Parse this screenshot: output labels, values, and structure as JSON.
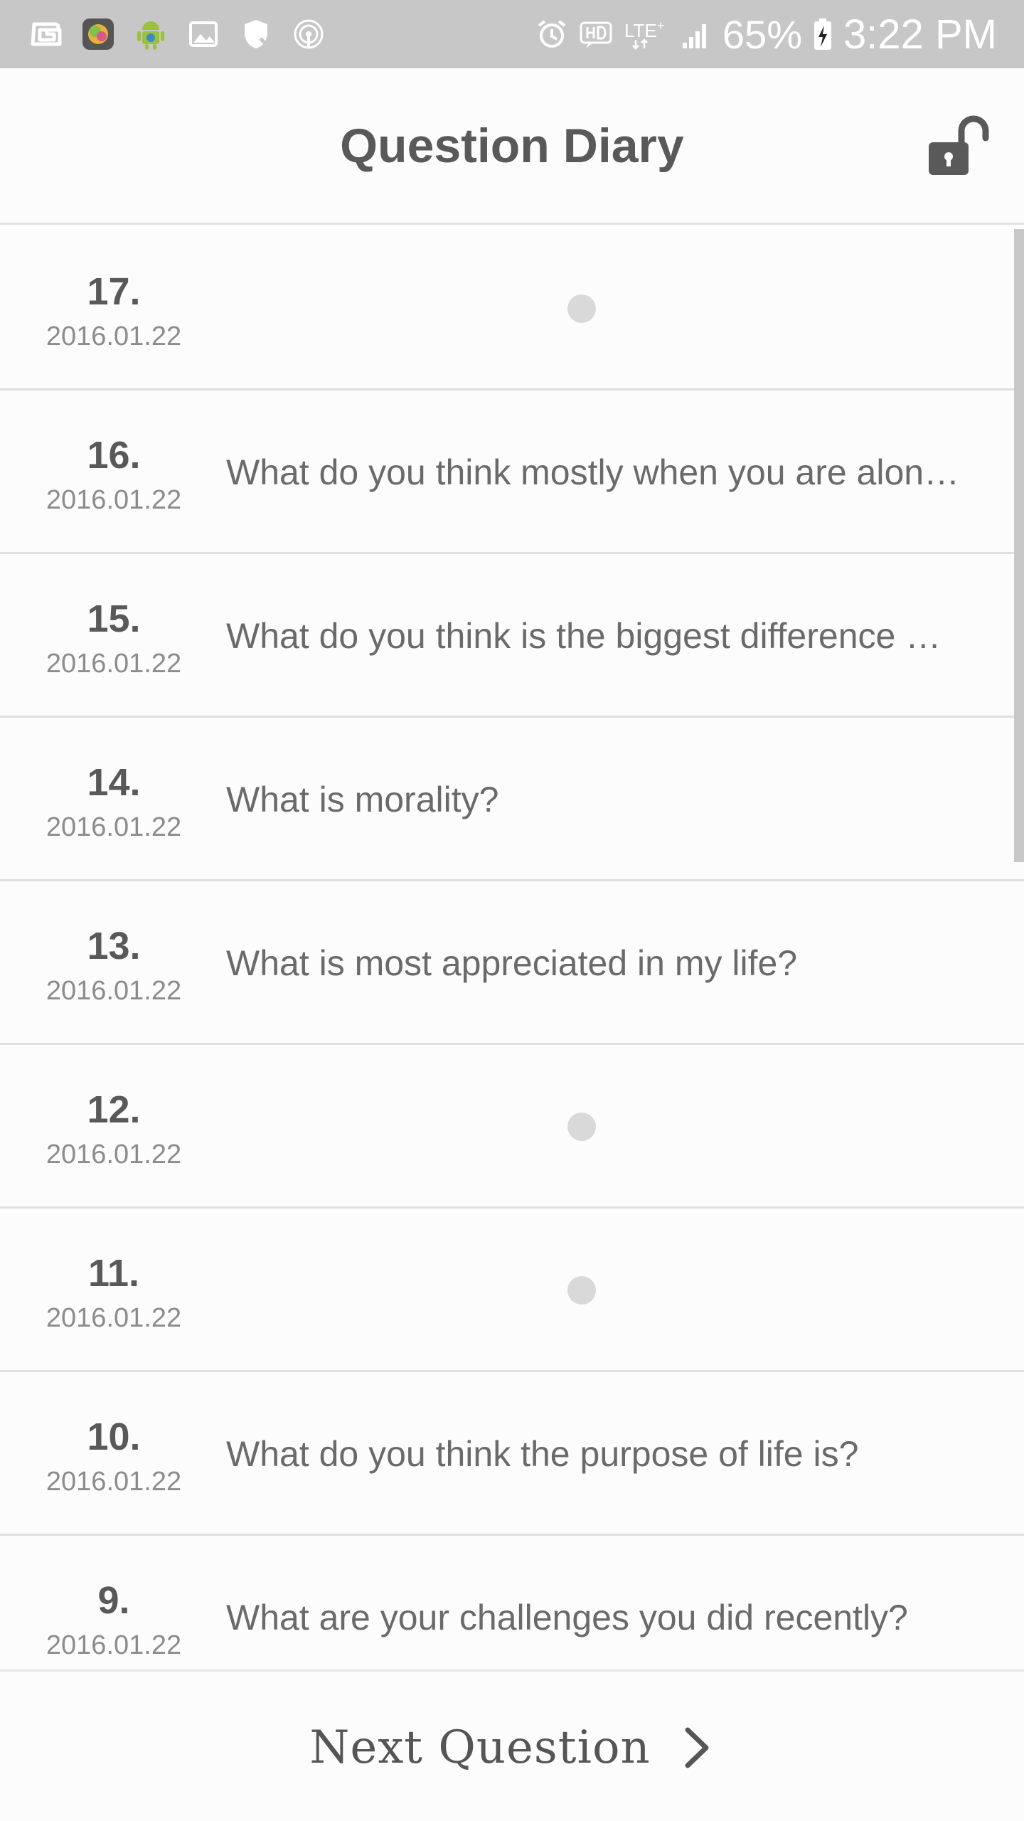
{
  "status_bar": {
    "battery_percent": "65%",
    "time": "3:22 PM",
    "icons_left": [
      "app-g-icon",
      "app-circle-icon",
      "android-debug-icon",
      "image-icon",
      "shield-icon",
      "hotspot-icon"
    ],
    "icons_right": [
      "alarm-icon",
      "hd-voice-icon",
      "lte-plus-icon",
      "signal-icon",
      "battery-charging-icon"
    ]
  },
  "header": {
    "title": "Question Diary",
    "lock_icon": "unlock-icon"
  },
  "list": {
    "items": [
      {
        "number": "17.",
        "date": "2016.01.22",
        "question": ""
      },
      {
        "number": "16.",
        "date": "2016.01.22",
        "question": "What do you think mostly when you are alon…"
      },
      {
        "number": "15.",
        "date": "2016.01.22",
        "question": "What do you think is the biggest difference …"
      },
      {
        "number": "14.",
        "date": "2016.01.22",
        "question": "What is morality?"
      },
      {
        "number": "13.",
        "date": "2016.01.22",
        "question": "What is most appreciated in my life?"
      },
      {
        "number": "12.",
        "date": "2016.01.22",
        "question": ""
      },
      {
        "number": "11.",
        "date": "2016.01.22",
        "question": ""
      },
      {
        "number": "10.",
        "date": "2016.01.22",
        "question": "What do you think the purpose of life is?"
      },
      {
        "number": "9.",
        "date": "2016.01.22",
        "question": "What are your challenges you did recently?"
      }
    ]
  },
  "footer": {
    "next_label": "Next Question",
    "next_icon": "chevron-right-icon"
  },
  "colors": {
    "status_bar_bg": "#c7c7c7",
    "background": "#fcfcfc",
    "title": "#595959",
    "text": "#6a6a6a",
    "date": "#8c8c8c",
    "divider": "#e0e0e0"
  }
}
